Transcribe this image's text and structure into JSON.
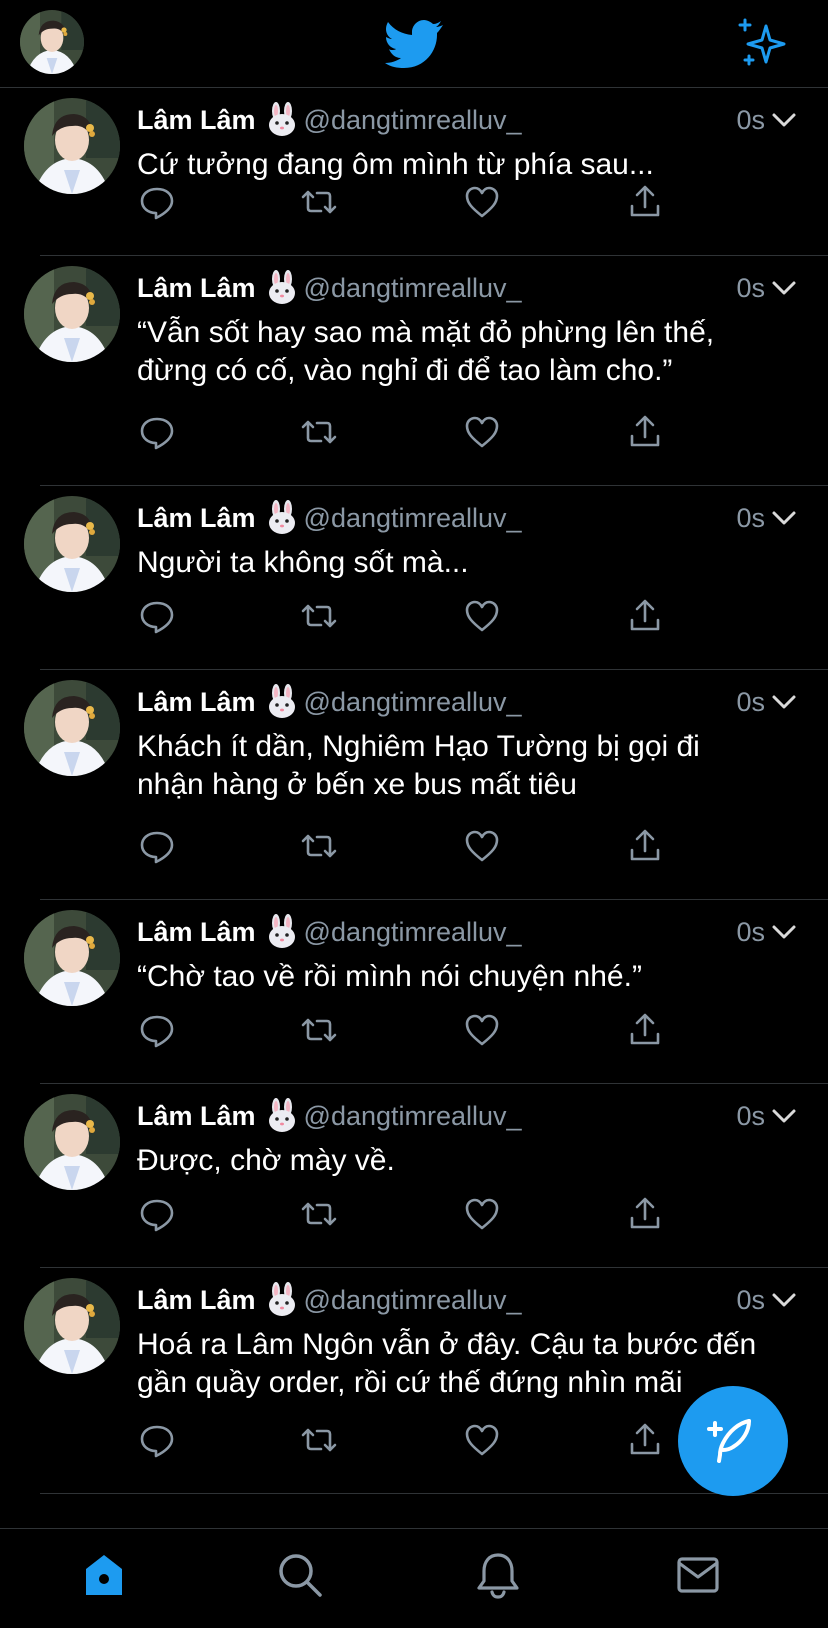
{
  "header": {
    "avatar": "user-avatar",
    "logo": "twitter-bird-icon",
    "action": "sparkle-icon"
  },
  "tweets": [
    {
      "name": "Lâm Lâm",
      "emoji": "rabbit-face",
      "handle": "@dangtimrealluv_",
      "time": "0s",
      "text": "Cứ tưởng đang ôm mình từ phía sau..."
    },
    {
      "name": "Lâm Lâm",
      "emoji": "rabbit-face",
      "handle": "@dangtimrealluv_",
      "time": "0s",
      "text": "“Vẫn sốt hay sao mà mặt đỏ phừng lên thế,\nđừng có cố, vào nghỉ đi để tao làm cho.”"
    },
    {
      "name": "Lâm Lâm",
      "emoji": "rabbit-face",
      "handle": "@dangtimrealluv_",
      "time": "0s",
      "text": "Người ta không sốt mà..."
    },
    {
      "name": "Lâm Lâm",
      "emoji": "rabbit-face",
      "handle": "@dangtimrealluv_",
      "time": "0s",
      "text": "Khách ít dần, Nghiêm Hạo Tường bị gọi đi\nnhận hàng ở bến xe bus mất tiêu"
    },
    {
      "name": "Lâm Lâm",
      "emoji": "rabbit-face",
      "handle": "@dangtimrealluv_",
      "time": "0s",
      "text": "“Chờ tao về rồi mình nói chuyện nhé.”"
    },
    {
      "name": "Lâm Lâm",
      "emoji": "rabbit-face",
      "handle": "@dangtimrealluv_",
      "time": "0s",
      "text": "Được, chờ mày về."
    },
    {
      "name": "Lâm Lâm",
      "emoji": "rabbit-face",
      "handle": "@dangtimrealluv_",
      "time": "0s",
      "text": "Hoá ra Lâm Ngôn vẫn ở đây. Cậu ta bước đến\ngần quầy order, rồi cứ thế đứng nhìn mãi"
    }
  ],
  "actions": [
    "reply-icon",
    "retweet-icon",
    "like-icon",
    "share-icon"
  ],
  "fab": "compose-tweet-icon",
  "tabs": [
    "home-icon",
    "search-icon",
    "notifications-icon",
    "messages-icon"
  ],
  "colors": {
    "accent": "#1d9bf0",
    "background": "#000000",
    "secondary_text": "#8b98a5",
    "divider": "#2f3336"
  }
}
